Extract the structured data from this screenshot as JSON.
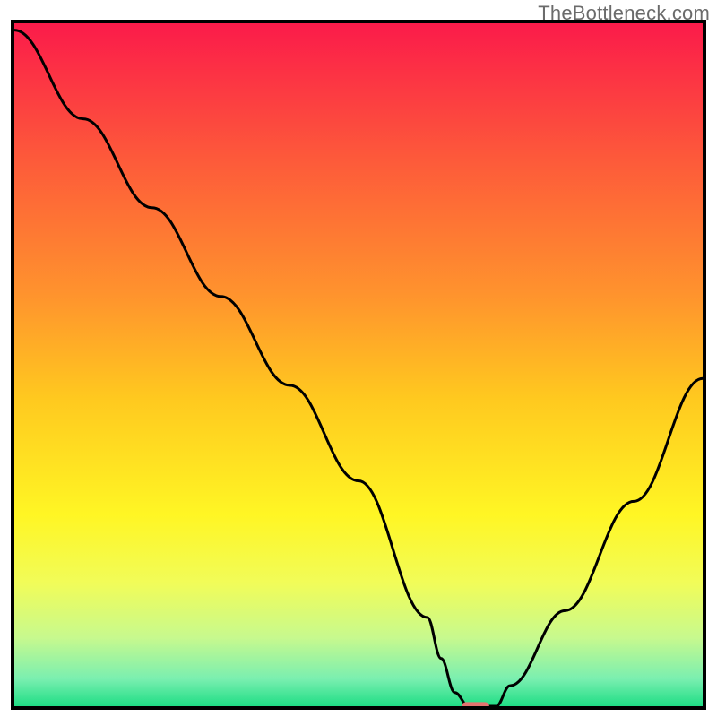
{
  "watermark": "TheBottleneck.com",
  "chart_data": {
    "type": "line",
    "title": "",
    "xlabel": "",
    "ylabel": "",
    "xlim": [
      0,
      100
    ],
    "ylim": [
      0,
      100
    ],
    "x": [
      0,
      10,
      20,
      30,
      40,
      50,
      60,
      62,
      64,
      66,
      68,
      70,
      72,
      80,
      90,
      100
    ],
    "values": [
      99,
      86,
      73,
      60,
      47,
      33,
      13,
      7,
      2,
      0,
      0,
      0,
      3,
      14,
      30,
      48
    ],
    "marker": {
      "x": 67,
      "y": 0,
      "color": "#e4736f",
      "width": 4,
      "height": 1.2,
      "rx": 0.6
    },
    "gradient_stops": [
      {
        "offset": 0.0,
        "color": "#fb1b4a"
      },
      {
        "offset": 0.2,
        "color": "#fd5a3a"
      },
      {
        "offset": 0.4,
        "color": "#ff942d"
      },
      {
        "offset": 0.55,
        "color": "#ffc91f"
      },
      {
        "offset": 0.72,
        "color": "#fff624"
      },
      {
        "offset": 0.82,
        "color": "#f1fc59"
      },
      {
        "offset": 0.9,
        "color": "#c7f98e"
      },
      {
        "offset": 0.96,
        "color": "#7aefb0"
      },
      {
        "offset": 1.0,
        "color": "#1fdd85"
      }
    ],
    "frame_color": "#000000",
    "frame_width": 4,
    "line_color": "#000000",
    "line_width": 3
  }
}
